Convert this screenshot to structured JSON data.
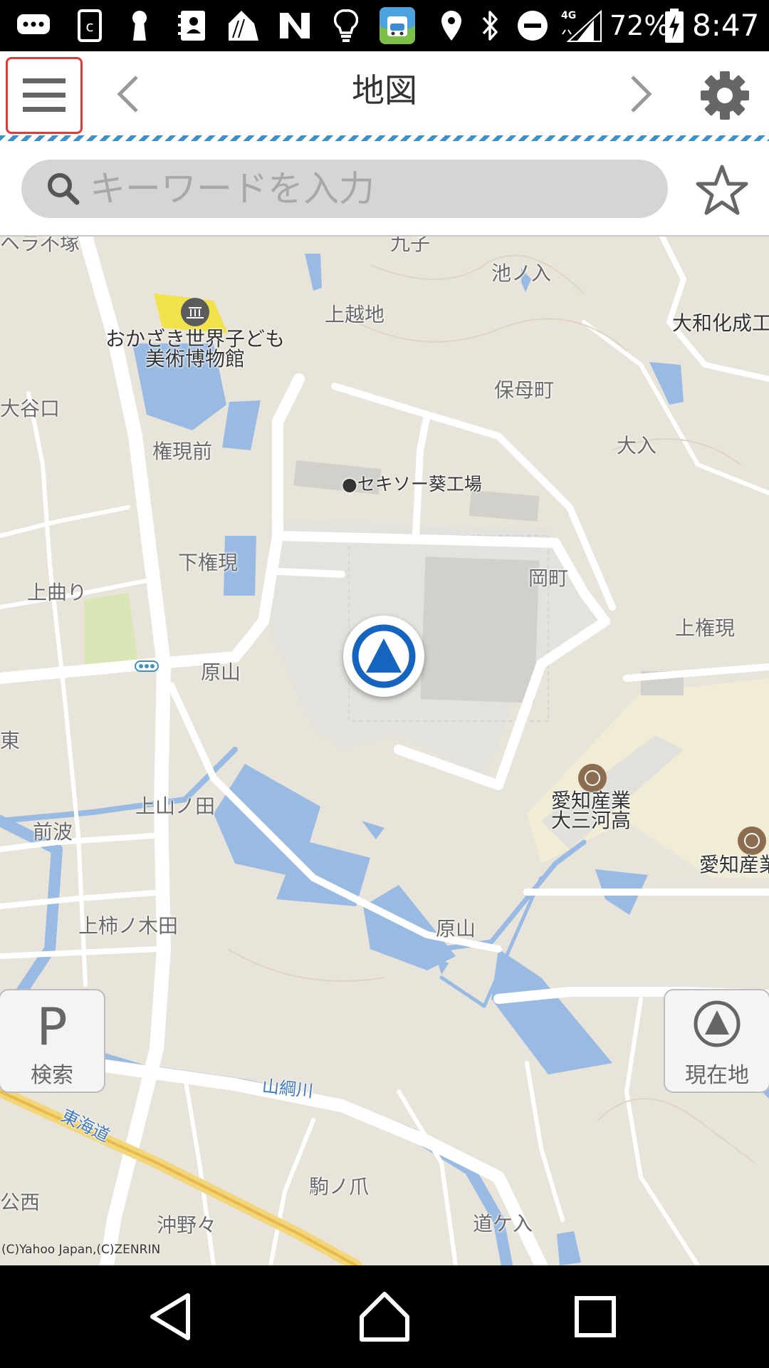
{
  "status_bar": {
    "network": "4G",
    "battery": "72%",
    "time": "8:47"
  },
  "header": {
    "title": "地図"
  },
  "search": {
    "placeholder": "キーワードを入力"
  },
  "map": {
    "labels": {
      "museum": "おかざき世界子ども\n美術博物館",
      "ikenoiri": "池ノ入",
      "kamikoshiji": "上越地",
      "daiwa": "大和化成工",
      "hobocho": "保母町",
      "otaniguchi": "大谷口",
      "ooiri": "大入",
      "gongenmae": "権現前",
      "sekiso": "●セキソー葵工場",
      "okacho": "岡町",
      "shimogongen": "下権現",
      "kamimagari": "上曲り",
      "kamigongen": "上権現",
      "harayama1": "原山",
      "school1": "愛知産業\n大三河高",
      "school2": "愛知産業",
      "kamiyamanota": "上山ノ田",
      "maenami": "前波",
      "kamikakinokida": "上柿ノ木田",
      "harayama2": "原山",
      "yamatsunagawa": "山綱川",
      "tokaido": "東海道",
      "komanotsume": "駒ノ爪",
      "michigairi": "道ケ入",
      "okinonono": "沖野々",
      "nishi": "公西",
      "higashi": "東",
      "top_partial1": "ヘラ不塚",
      "top_partial2": "九子"
    },
    "copyright": "(C)Yahoo Japan,(C)ZENRIN"
  },
  "buttons": {
    "parking_icon": "P",
    "parking_label": "検索",
    "current_label": "現在地"
  },
  "colors": {
    "map_land": "#e9e4d9",
    "water": "#99bbe3",
    "road": "#ffffff",
    "accent": "#1565c0",
    "menu_highlight": "#e53935"
  }
}
